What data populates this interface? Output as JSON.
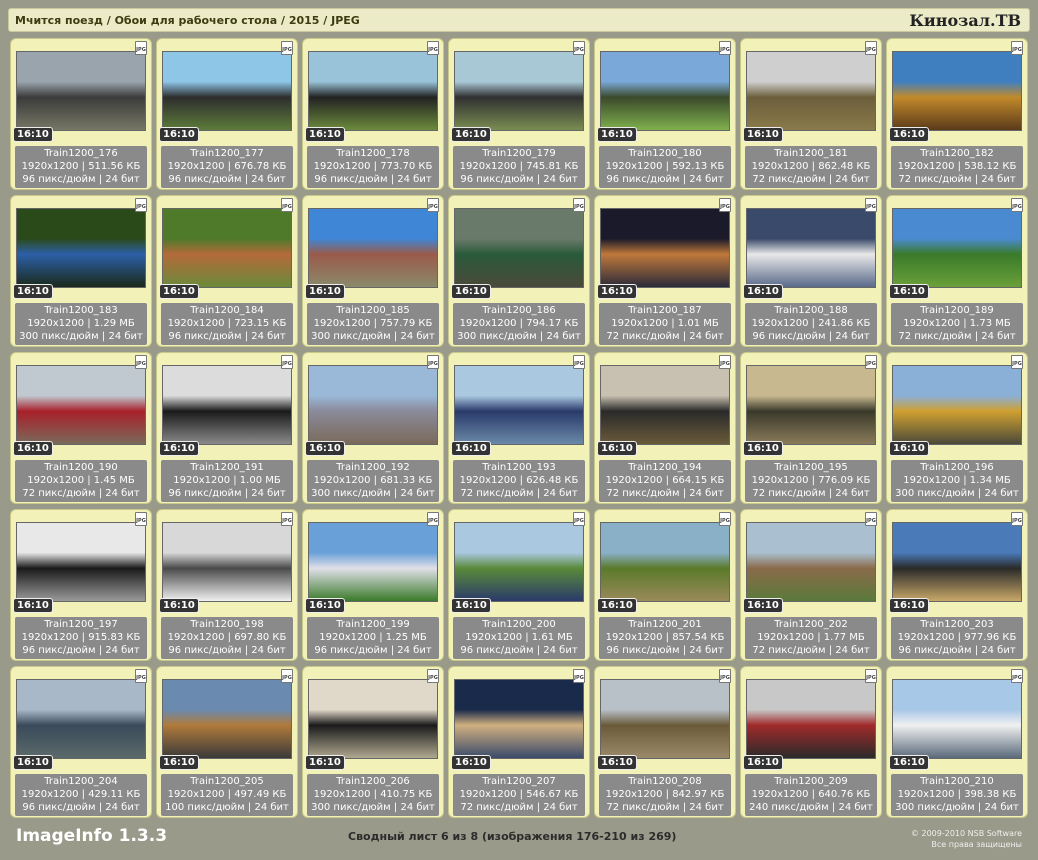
{
  "header": {
    "path": "Мчится поезд / Обои для рабочего стола / 2015 / JPEG",
    "brand": "Кинозал.ТВ"
  },
  "file_badge": "JPG",
  "tiles": [
    {
      "name": "Train1200_176",
      "dims": "1920x1200 | 511.56 КБ",
      "meta": "96 пикс/дюйм | 24 бит",
      "ratio": "16:10",
      "colors": [
        "#9aa4ad",
        "#3b3b3b",
        "#777766"
      ]
    },
    {
      "name": "Train1200_177",
      "dims": "1920x1200 | 676.78 КБ",
      "meta": "96 пикс/дюйм | 24 бит",
      "ratio": "16:10",
      "colors": [
        "#8ec6e8",
        "#2d2d2d",
        "#5d7c3a"
      ]
    },
    {
      "name": "Train1200_178",
      "dims": "1920x1200 | 773.70 КБ",
      "meta": "96 пикс/дюйм | 24 бит",
      "ratio": "16:10",
      "colors": [
        "#98c3d8",
        "#222222",
        "#6c8b3c"
      ]
    },
    {
      "name": "Train1200_179",
      "dims": "1920x1200 | 745.81 КБ",
      "meta": "96 пикс/дюйм | 24 бит",
      "ratio": "16:10",
      "colors": [
        "#a9c8d6",
        "#303030",
        "#7a8d52"
      ]
    },
    {
      "name": "Train1200_180",
      "dims": "1920x1200 | 592.13 КБ",
      "meta": "96 пикс/дюйм | 24 бит",
      "ratio": "16:10",
      "colors": [
        "#7aa8d8",
        "#3a4a2a",
        "#7fb04d"
      ]
    },
    {
      "name": "Train1200_181",
      "dims": "1920x1200 | 862.48 КБ",
      "meta": "72 пикс/дюйм | 24 бит",
      "ratio": "16:10",
      "colors": [
        "#cfcfcf",
        "#6b5e3b",
        "#8a7a4a"
      ]
    },
    {
      "name": "Train1200_182",
      "dims": "1920x1200 | 538.12 КБ",
      "meta": "72 пикс/дюйм | 24 бит",
      "ratio": "16:10",
      "colors": [
        "#3f7fc0",
        "#c28a2a",
        "#5a3a1a"
      ]
    },
    {
      "name": "Train1200_183",
      "dims": "1920x1200 | 1.29 МБ",
      "meta": "300 пикс/дюйм | 24 бит",
      "ratio": "16:10",
      "colors": [
        "#2a4a1a",
        "#2d5fa8",
        "#1a2a1a"
      ]
    },
    {
      "name": "Train1200_184",
      "dims": "1920x1200 | 723.15 КБ",
      "meta": "96 пикс/дюйм | 24 бит",
      "ratio": "16:10",
      "colors": [
        "#4e7a2a",
        "#b46a3a",
        "#6a8a3a"
      ]
    },
    {
      "name": "Train1200_185",
      "dims": "1920x1200 | 757.79 КБ",
      "meta": "300 пикс/дюйм | 24 бит",
      "ratio": "16:10",
      "colors": [
        "#3f86d6",
        "#9a5a4a",
        "#8a8a6a"
      ]
    },
    {
      "name": "Train1200_186",
      "dims": "1920x1200 | 794.17 КБ",
      "meta": "300 пикс/дюйм | 24 бит",
      "ratio": "16:10",
      "colors": [
        "#6a7a6a",
        "#2a5a3a",
        "#4a4a3a"
      ]
    },
    {
      "name": "Train1200_187",
      "dims": "1920x1200 | 1.01 МБ",
      "meta": "72 пикс/дюйм | 24 бит",
      "ratio": "16:10",
      "colors": [
        "#1a1a2a",
        "#c0783a",
        "#2a2a3a"
      ]
    },
    {
      "name": "Train1200_188",
      "dims": "1920x1200 | 241.86 КБ",
      "meta": "96 пикс/дюйм | 24 бит",
      "ratio": "16:10",
      "colors": [
        "#3a4a6a",
        "#e8e8e8",
        "#5a6a8a"
      ]
    },
    {
      "name": "Train1200_189",
      "dims": "1920x1200 | 1.73 МБ",
      "meta": "72 пикс/дюйм | 24 бит",
      "ratio": "16:10",
      "colors": [
        "#4a8ad0",
        "#3a7a2a",
        "#6aa03a"
      ]
    },
    {
      "name": "Train1200_190",
      "dims": "1920x1200 | 1.45 МБ",
      "meta": "72 пикс/дюйм | 24 бит",
      "ratio": "16:10",
      "colors": [
        "#c0c8d0",
        "#a8202a",
        "#7a6a5a"
      ]
    },
    {
      "name": "Train1200_191",
      "dims": "1920x1200 | 1.00 МБ",
      "meta": "96 пикс/дюйм | 24 бит",
      "ratio": "16:10",
      "colors": [
        "#dcdcdc",
        "#1a1a1a",
        "#8a8a8a"
      ]
    },
    {
      "name": "Train1200_192",
      "dims": "1920x1200 | 681.33 КБ",
      "meta": "300 пикс/дюйм | 24 бит",
      "ratio": "16:10",
      "colors": [
        "#9ab8d8",
        "#8a8a9a",
        "#7a6a5a"
      ]
    },
    {
      "name": "Train1200_193",
      "dims": "1920x1200 | 626.48 КБ",
      "meta": "72 пикс/дюйм | 24 бит",
      "ratio": "16:10",
      "colors": [
        "#aac8e0",
        "#2a3a6a",
        "#6a8aa8"
      ]
    },
    {
      "name": "Train1200_194",
      "dims": "1920x1200 | 664.15 КБ",
      "meta": "72 пикс/дюйм | 24 бит",
      "ratio": "16:10",
      "colors": [
        "#c8c0b0",
        "#2a2a2a",
        "#6a5a3a"
      ]
    },
    {
      "name": "Train1200_195",
      "dims": "1920x1200 | 776.09 КБ",
      "meta": "72 пикс/дюйм | 24 бит",
      "ratio": "16:10",
      "colors": [
        "#c8b890",
        "#3a3a2a",
        "#8a7a5a"
      ]
    },
    {
      "name": "Train1200_196",
      "dims": "1920x1200 | 1.34 МБ",
      "meta": "300 пикс/дюйм | 24 бит",
      "ratio": "16:10",
      "colors": [
        "#8ab0d8",
        "#d0a030",
        "#4a4a3a"
      ]
    },
    {
      "name": "Train1200_197",
      "dims": "1920x1200 | 915.83 КБ",
      "meta": "96 пикс/дюйм | 24 бит",
      "ratio": "16:10",
      "colors": [
        "#e8e8e8",
        "#1a1a1a",
        "#9a9a9a"
      ]
    },
    {
      "name": "Train1200_198",
      "dims": "1920x1200 | 697.80 КБ",
      "meta": "96 пикс/дюйм | 24 бит",
      "ratio": "16:10",
      "colors": [
        "#d8d8d8",
        "#4a4a4a",
        "#f0f0f0"
      ]
    },
    {
      "name": "Train1200_199",
      "dims": "1920x1200 | 1.25 МБ",
      "meta": "96 пикс/дюйм | 24 бит",
      "ratio": "16:10",
      "colors": [
        "#6aa0d8",
        "#e0e0e8",
        "#3a7a2a"
      ]
    },
    {
      "name": "Train1200_200",
      "dims": "1920x1200 | 1.61 МБ",
      "meta": "96 пикс/дюйм | 24 бит",
      "ratio": "16:10",
      "colors": [
        "#aac8e0",
        "#5a8a3a",
        "#2a3a6a"
      ]
    },
    {
      "name": "Train1200_201",
      "dims": "1920x1200 | 857.54 КБ",
      "meta": "96 пикс/дюйм | 24 бит",
      "ratio": "16:10",
      "colors": [
        "#8ab0c8",
        "#5a7a2a",
        "#9a8a5a"
      ]
    },
    {
      "name": "Train1200_202",
      "dims": "1920x1200 | 1.77 МБ",
      "meta": "72 пикс/дюйм | 24 бит",
      "ratio": "16:10",
      "colors": [
        "#aac0d0",
        "#8a6a4a",
        "#5a7a3a"
      ]
    },
    {
      "name": "Train1200_203",
      "dims": "1920x1200 | 977.96 КБ",
      "meta": "96 пикс/дюйм | 24 бит",
      "ratio": "16:10",
      "colors": [
        "#4a7ab8",
        "#2a2a2a",
        "#c8a868"
      ]
    },
    {
      "name": "Train1200_204",
      "dims": "1920x1200 | 429.11 КБ",
      "meta": "96 пикс/дюйм | 24 бит",
      "ratio": "16:10",
      "colors": [
        "#a8b8c8",
        "#3a4a5a",
        "#5a6a6a"
      ]
    },
    {
      "name": "Train1200_205",
      "dims": "1920x1200 | 497.49 КБ",
      "meta": "100 пикс/дюйм | 24 бит",
      "ratio": "16:10",
      "colors": [
        "#6a8ab0",
        "#b07a3a",
        "#3a3a3a"
      ]
    },
    {
      "name": "Train1200_206",
      "dims": "1920x1200 | 410.75 КБ",
      "meta": "300 пикс/дюйм | 24 бит",
      "ratio": "16:10",
      "colors": [
        "#e0d8c8",
        "#1a1a1a",
        "#b0a890"
      ]
    },
    {
      "name": "Train1200_207",
      "dims": "1920x1200 | 546.67 КБ",
      "meta": "72 пикс/дюйм | 24 бит",
      "ratio": "16:10",
      "colors": [
        "#1a2a4a",
        "#d0b080",
        "#3a4a6a"
      ]
    },
    {
      "name": "Train1200_208",
      "dims": "1920x1200 | 842.97 КБ",
      "meta": "72 пикс/дюйм | 24 бит",
      "ratio": "16:10",
      "colors": [
        "#b8c0c8",
        "#6a5a3a",
        "#9a8a6a"
      ]
    },
    {
      "name": "Train1200_209",
      "dims": "1920x1200 | 640.76 КБ",
      "meta": "240 пикс/дюйм | 24 бит",
      "ratio": "16:10",
      "colors": [
        "#c8c8c8",
        "#a02a2a",
        "#2a2a2a"
      ]
    },
    {
      "name": "Train1200_210",
      "dims": "1920x1200 | 398.38 КБ",
      "meta": "300 пикс/дюйм | 24 бит",
      "ratio": "16:10",
      "colors": [
        "#a8c8e8",
        "#f0f0f0",
        "#5a6a7a"
      ]
    }
  ],
  "footer": {
    "app": "ImageInfo 1.3.3",
    "sheet": "Сводный лист 6 из 8 (изображения 176-210 из 269)",
    "copyright": "© 2009-2010 NSB Software",
    "rights": "Все права защищены"
  }
}
